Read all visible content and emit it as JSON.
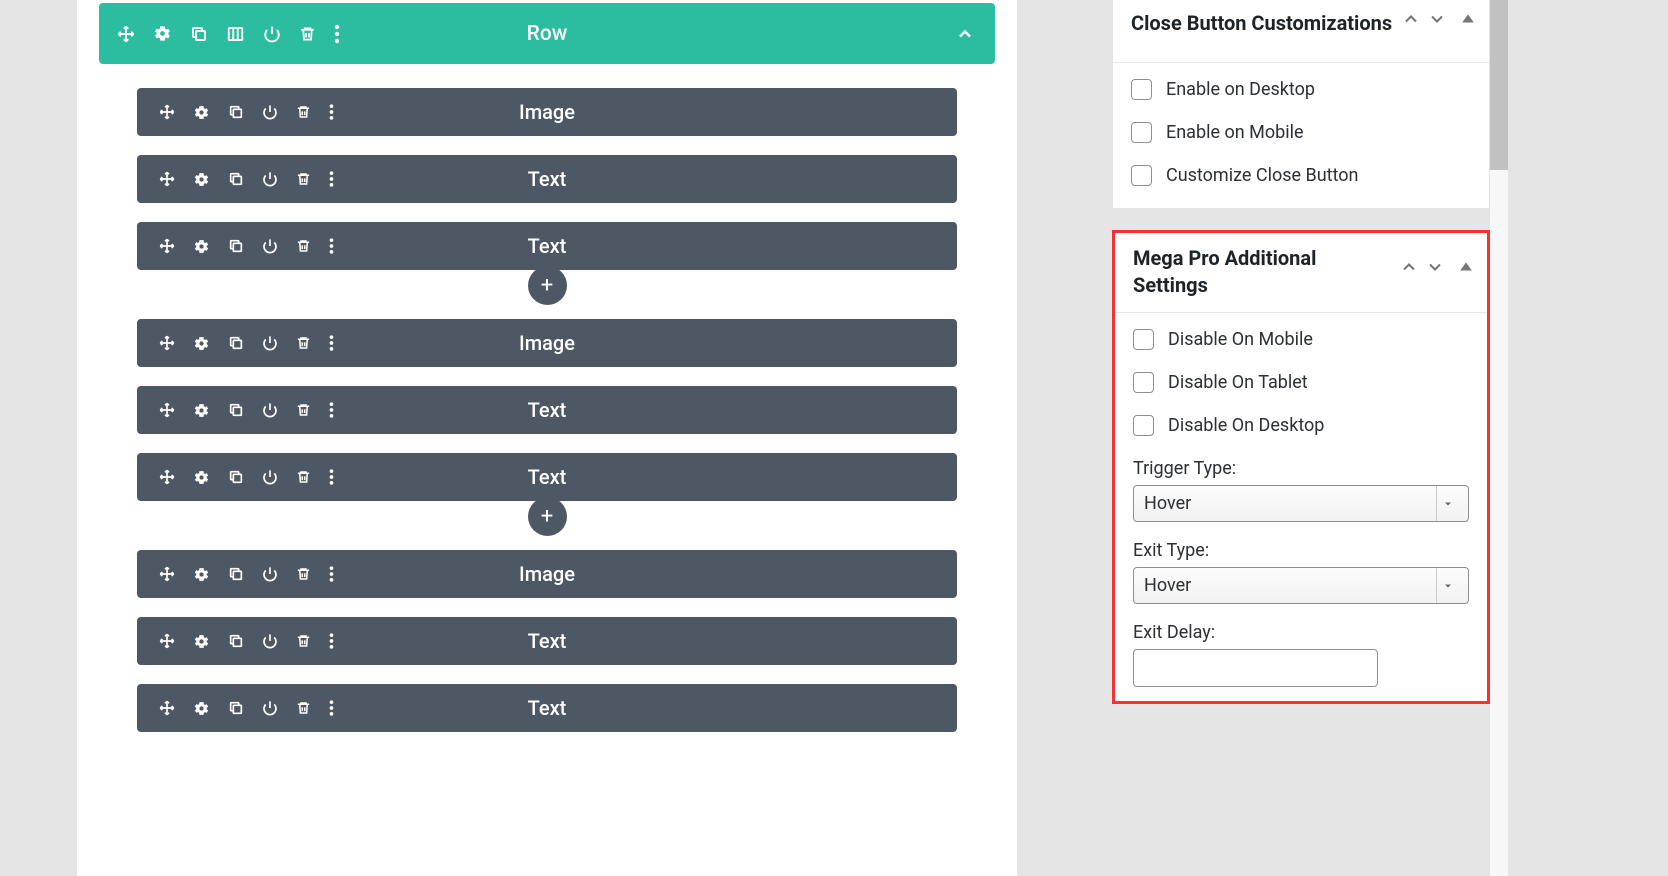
{
  "row": {
    "title": "Row"
  },
  "blocks": {
    "group1": [
      "Image",
      "Text",
      "Text"
    ],
    "group2": [
      "Image",
      "Text",
      "Text"
    ],
    "group3": [
      "Image",
      "Text",
      "Text"
    ]
  },
  "panel1": {
    "title": "Close Button Customizations",
    "checks": [
      {
        "label": "Enable on Desktop"
      },
      {
        "label": "Enable on Mobile"
      },
      {
        "label": "Customize Close Button"
      }
    ]
  },
  "panel2": {
    "title": "Mega Pro Additional Settings",
    "checks": [
      {
        "label": "Disable On Mobile"
      },
      {
        "label": "Disable On Tablet"
      },
      {
        "label": "Disable On Desktop"
      }
    ],
    "trigger_label": "Trigger Type:",
    "trigger_value": "Hover",
    "exit_label": "Exit Type:",
    "exit_value": "Hover",
    "delay_label": "Exit Delay:",
    "delay_value": ""
  }
}
